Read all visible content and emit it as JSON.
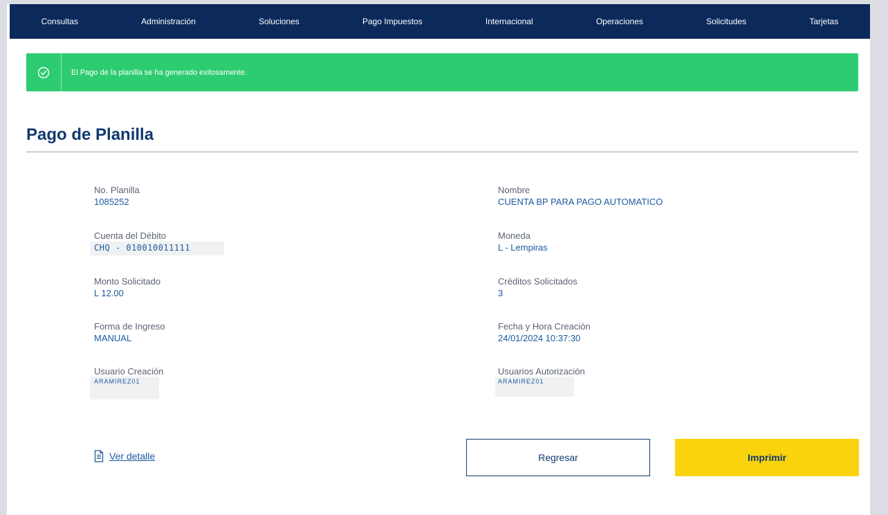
{
  "nav": {
    "items": [
      {
        "label": "Consultas"
      },
      {
        "label": "Administración"
      },
      {
        "label": "Soluciones"
      },
      {
        "label": "Pago Impuestos"
      },
      {
        "label": "Internacional"
      },
      {
        "label": "Operaciones"
      },
      {
        "label": "Solicitudes"
      },
      {
        "label": "Tarjetas"
      }
    ]
  },
  "alert": {
    "message": "El Pago de la planilla se ha generado exitosamente.",
    "icon": "check-circle-icon",
    "color": "#2ecc71"
  },
  "page": {
    "title": "Pago de Planilla"
  },
  "details": {
    "left": [
      {
        "label": "No. Planilla",
        "value": "1085252"
      },
      {
        "label": "Cuenta del Débito",
        "value": "CHQ - 010010011111"
      },
      {
        "label": "Monto Solicitado",
        "value": "L 12.00"
      },
      {
        "label": "Forma de Ingreso",
        "value": "MANUAL"
      },
      {
        "label": "Usuario Creación",
        "value": "ARAMIREZ01"
      }
    ],
    "right": [
      {
        "label": "Nombre",
        "value": "CUENTA BP PARA PAGO AUTOMATICO"
      },
      {
        "label": "Moneda",
        "value": "L - Lempiras"
      },
      {
        "label": "Créditos Solicitados",
        "value": "3"
      },
      {
        "label": "Fecha y Hora Creación",
        "value": "24/01/2024 10:37:30"
      },
      {
        "label": "Usuarios Autorización",
        "value": "ARAMIREZ01"
      }
    ]
  },
  "actions": {
    "detail_link": "Ver detalle",
    "detail_icon": "document-icon",
    "back_label": "Regresar",
    "print_label": "Imprimir"
  },
  "colors": {
    "navbar": "#0b2a5b",
    "success": "#2ecc71",
    "primary_text": "#123a6d",
    "value_text": "#1c5aa0",
    "print_button": "#f9d40e"
  }
}
